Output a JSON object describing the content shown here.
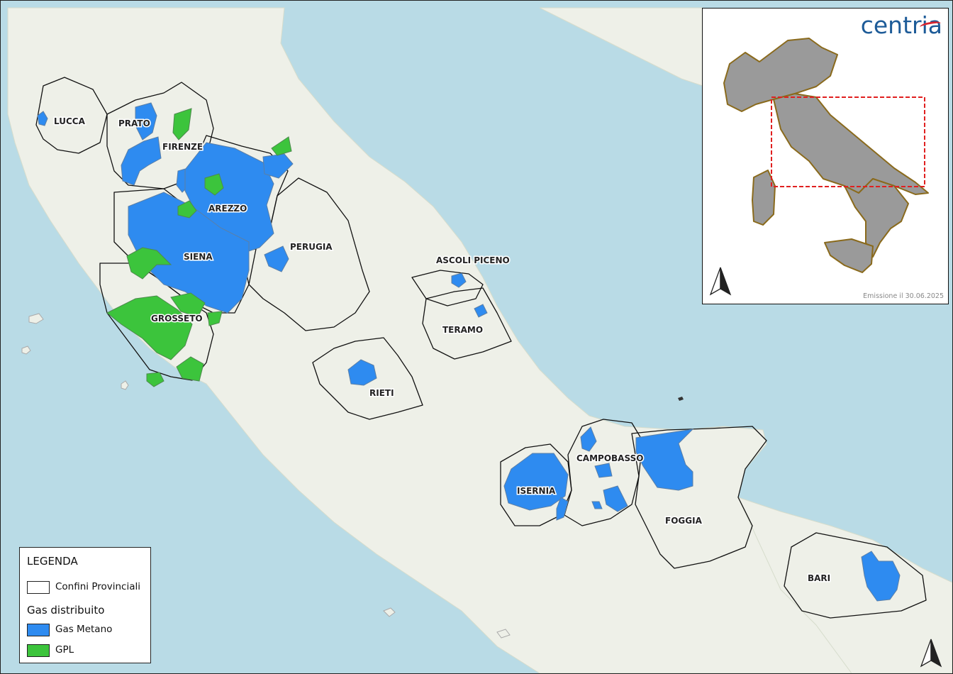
{
  "logo": {
    "text": "centria",
    "accent_color": "#d8242f",
    "brand_color": "#1d5b98"
  },
  "emission": "Emissione il 30.06.2025",
  "legend": {
    "title": "LEGENDA",
    "boundary_label": "Confini Provinciali",
    "section_title": "Gas distribuito",
    "items": [
      {
        "label": "Gas Metano",
        "color": "#2e8bf0"
      },
      {
        "label": "GPL",
        "color": "#3cc43c"
      }
    ]
  },
  "provinces": [
    {
      "name": "LUCCA"
    },
    {
      "name": "PRATO"
    },
    {
      "name": "FIRENZE"
    },
    {
      "name": "AREZZO"
    },
    {
      "name": "SIENA"
    },
    {
      "name": "PERUGIA"
    },
    {
      "name": "GROSSETO"
    },
    {
      "name": "ASCOLI PICENO"
    },
    {
      "name": "TERAMO"
    },
    {
      "name": "RIETI"
    },
    {
      "name": "CAMPOBASSO"
    },
    {
      "name": "ISERNIA"
    },
    {
      "name": "FOGGIA"
    },
    {
      "name": "BARI"
    }
  ],
  "colors": {
    "sea": "#b9dbe6",
    "land": "#eef0e8",
    "metano": "#2e8bf0",
    "gpl": "#3cc43c",
    "inset_land": "#9a9a9a",
    "inset_border": "#8a6a1c",
    "extent_box": "#e02020"
  },
  "icons": [
    "north-arrow-icon"
  ]
}
